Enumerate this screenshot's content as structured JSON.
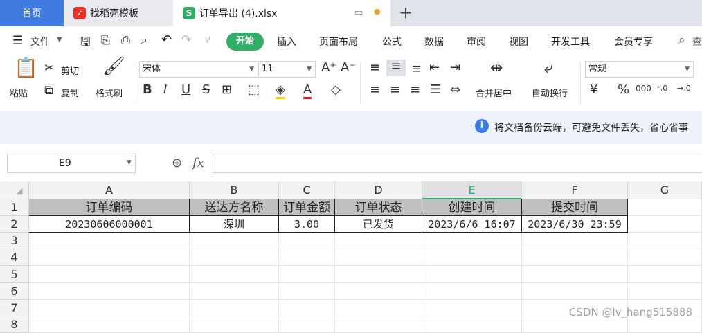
{
  "tabs": {
    "home": "首页",
    "template": "找稻壳模板",
    "file": "订单导出 (4).xlsx",
    "add": "+"
  },
  "menu": {
    "file": "文件",
    "start": "开始",
    "insert": "插入",
    "layout": "页面布局",
    "formula": "公式",
    "data": "数据",
    "review": "审阅",
    "view": "视图",
    "dev": "开发工具",
    "member": "会员专享",
    "search": "查"
  },
  "ribbon": {
    "paste": "粘贴",
    "cut": "剪切",
    "copy": "复制",
    "format_painter": "格式刷",
    "font": "宋体",
    "font_size": "11",
    "merge": "合并居中",
    "wrap": "自动换行",
    "number_format": "常规",
    "currency": "¥",
    "percent": "%"
  },
  "info": {
    "message": "将文档备份云端，可避免文件丢失，省心省事"
  },
  "formula_bar": {
    "cell_ref": "E9",
    "fx": "fx",
    "value": ""
  },
  "sheet": {
    "columns": [
      "A",
      "B",
      "C",
      "D",
      "E",
      "F",
      "G"
    ],
    "rows": [
      "1",
      "2",
      "3",
      "4",
      "5",
      "6",
      "7",
      "8"
    ],
    "header_row": [
      "订单编码",
      "送达方名称",
      "订单金额",
      "订单状态",
      "创建时间",
      "提交时间"
    ],
    "data_row": [
      "20230606000001",
      "深圳",
      "3.00",
      "已发货",
      "2023/6/6 16:07",
      "2023/6/30 23:59"
    ],
    "selected_column": "E",
    "selected_color": "#2fae67"
  },
  "watermark": "CSDN @lv_hang515888"
}
